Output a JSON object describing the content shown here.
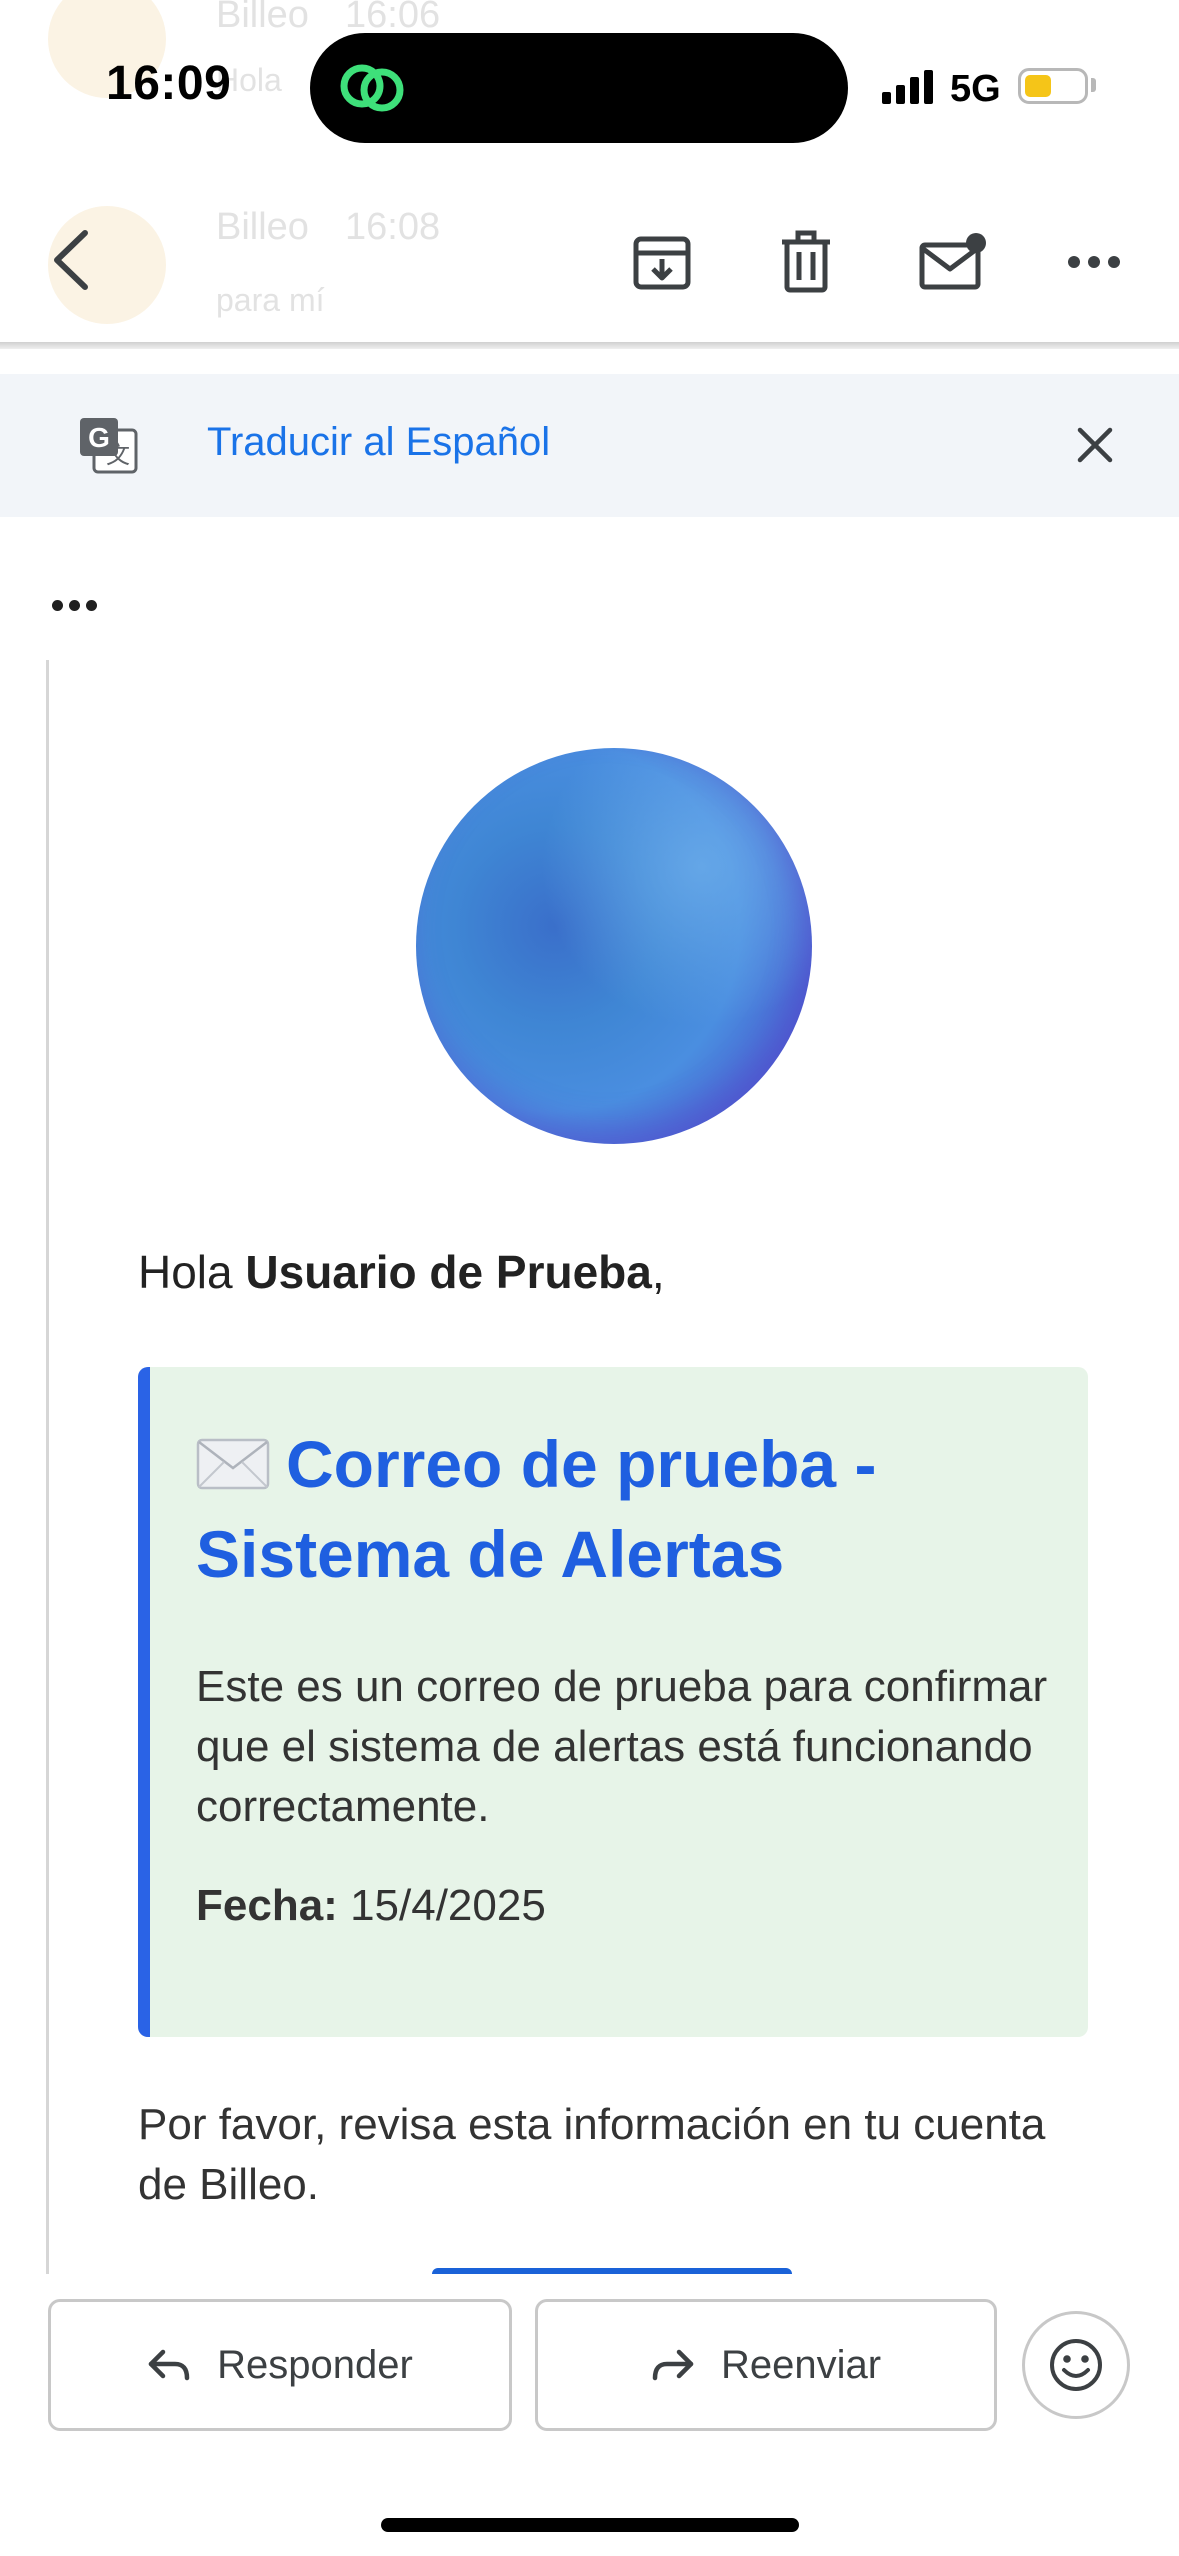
{
  "background_list": {
    "item1": {
      "sender": "Billeo",
      "time": "16:06",
      "preview": "Hola"
    },
    "item2": {
      "sender": "Billeo",
      "time": "16:08",
      "preview": "para mí"
    }
  },
  "status_bar": {
    "time": "16:09",
    "network": "5G",
    "battery_color": "#f5c518"
  },
  "toolbar": {
    "back_icon": "chevron-left-icon",
    "archive_icon": "archive-icon",
    "delete_icon": "trash-icon",
    "unread_icon": "mark-unread-icon",
    "more_icon": "more-horizontal-icon"
  },
  "translate_bar": {
    "link_label": "Traducir al Español",
    "icon": "google-translate-icon",
    "close_icon": "close-icon"
  },
  "email": {
    "greeting_prefix": "Hola ",
    "recipient_name": "Usuario de Prueba",
    "greeting_suffix": ",",
    "card": {
      "title": "Correo de prueba - Sistema de Alertas",
      "body": "Este es un correo de prueba para confirmar que el sistema de alertas está funcionando correctamente.",
      "date_label": "Fecha:",
      "date_value": "15/4/2025",
      "accent_color": "#2a63e6",
      "background_color": "#e7f4e8"
    },
    "closing": "Por favor, revisa esta información en tu cuenta de Billeo."
  },
  "actions": {
    "reply_label": "Responder",
    "forward_label": "Reenviar",
    "emoji_icon": "smiley-icon"
  }
}
